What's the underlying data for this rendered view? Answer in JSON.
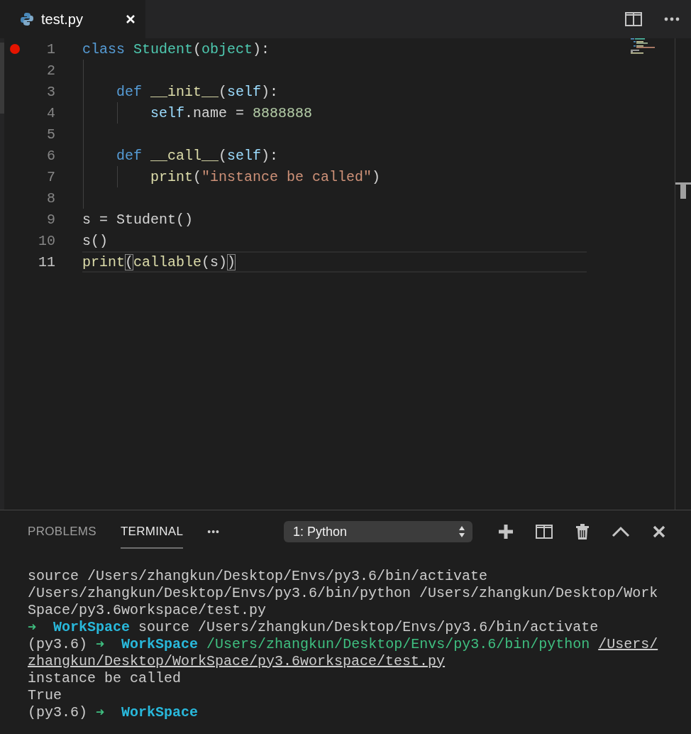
{
  "tabs": [
    {
      "label": "test.py",
      "selected": true
    }
  ],
  "editor": {
    "lines": [
      {
        "number": "1",
        "breakpoint": true,
        "current": false,
        "tokens": [
          {
            "kind": "keyword",
            "text": "class"
          },
          {
            "kind": "type",
            "text": "Student"
          },
          {
            "kind": "plain",
            "text": "("
          },
          {
            "kind": "type",
            "text": "object"
          },
          {
            "kind": "plain",
            "text": "):"
          }
        ],
        "children": [
          {
            "number": "2",
            "breakpoint": false,
            "current": false
          },
          {
            "number": "3",
            "breakpoint": false,
            "current": false,
            "tokens": [
              {
                "kind": "keyword",
                "text": "def"
              },
              {
                "kind": "function",
                "text": "__init__"
              },
              {
                "kind": "plain",
                "text": "("
              },
              {
                "kind": "variable",
                "text": "self"
              },
              {
                "kind": "plain",
                "text": "):"
              }
            ],
            "children": [
              {
                "number": "4",
                "breakpoint": false,
                "current": false,
                "tokens": [
                  {
                    "kind": "variable",
                    "text": "self"
                  },
                  {
                    "kind": "plain",
                    "text": ".name = "
                  },
                  {
                    "kind": "number",
                    "text": "8888888"
                  }
                ]
              }
            ]
          },
          {
            "number": "5",
            "breakpoint": false,
            "current": false
          },
          {
            "number": "6",
            "breakpoint": false,
            "current": false,
            "tokens": [
              {
                "kind": "keyword",
                "text": "def"
              },
              {
                "kind": "function",
                "text": "__call__"
              },
              {
                "kind": "plain",
                "text": "("
              },
              {
                "kind": "variable",
                "text": "self"
              },
              {
                "kind": "plain",
                "text": "):"
              }
            ],
            "children": [
              {
                "number": "7",
                "breakpoint": false,
                "current": false,
                "tokens": [
                  {
                    "kind": "function",
                    "text": "print"
                  },
                  {
                    "kind": "plain",
                    "text": "("
                  },
                  {
                    "kind": "string",
                    "text": "\"instance be called\""
                  },
                  {
                    "kind": "plain",
                    "text": ")"
                  }
                ]
              }
            ]
          },
          {
            "number": "8",
            "breakpoint": false,
            "current": false
          }
        ]
      },
      {
        "number": "9",
        "breakpoint": false,
        "current": false,
        "tokens": [
          {
            "kind": "plain",
            "text": "s = Student()"
          }
        ]
      },
      {
        "number": "10",
        "breakpoint": false,
        "current": false,
        "tokens": [
          {
            "kind": "plain",
            "text": "s()"
          }
        ]
      },
      {
        "number": "11",
        "breakpoint": false,
        "current": true,
        "tokens": [
          {
            "kind": "function",
            "text": "print"
          },
          {
            "kind": "bracket",
            "text": "("
          },
          {
            "kind": "function",
            "text": "callable"
          },
          {
            "kind": "plain",
            "text": "(s)"
          },
          {
            "kind": "bracket",
            "text": ")"
          }
        ]
      }
    ]
  },
  "panel": {
    "tabs": [
      {
        "label": "PROBLEMS",
        "selected": false
      },
      {
        "label": "TERMINAL",
        "selected": true
      }
    ],
    "more": "•••",
    "terminal_select": {
      "value": "1: Python"
    },
    "terminal": [
      [
        {
          "kind": "plain",
          "text": "source /Users/zhangkun/Desktop/Envs/py3.6/bin/activate"
        }
      ],
      [
        {
          "kind": "plain",
          "text": "/Users/zhangkun/Desktop/Envs/py3.6/bin/python /Users/zhangkun/Desktop/Work"
        }
      ],
      [
        {
          "kind": "plain",
          "text": "Space/py3.6workspace/test.py"
        }
      ],
      [
        {
          "kind": "arrow",
          "text": "➜"
        },
        {
          "kind": "dir",
          "text": "WorkSpace"
        },
        {
          "kind": "plain",
          "text": "source /Users/zhangkun/Desktop/Envs/py3.6/bin/activate"
        }
      ],
      [
        {
          "kind": "plain",
          "text": "(py3.6)"
        },
        {
          "kind": "arrow",
          "text": "➜"
        },
        {
          "kind": "dir",
          "text": "WorkSpace"
        },
        {
          "kind": "command",
          "text": "/Users/zhangkun/Desktop/Envs/py3.6/bin/python"
        },
        {
          "kind": "link",
          "text": "/Users/"
        }
      ],
      [
        {
          "kind": "link",
          "text": "zhangkun/Desktop/WorkSpace/py3.6workspace/test.py"
        }
      ],
      [
        {
          "kind": "plain",
          "text": "instance be called"
        }
      ],
      [
        {
          "kind": "plain",
          "text": "True"
        }
      ],
      [
        {
          "kind": "plain",
          "text": "(py3.6)"
        },
        {
          "kind": "arrow",
          "text": "➜"
        },
        {
          "kind": "dir",
          "text": "WorkSpace"
        }
      ]
    ]
  }
}
